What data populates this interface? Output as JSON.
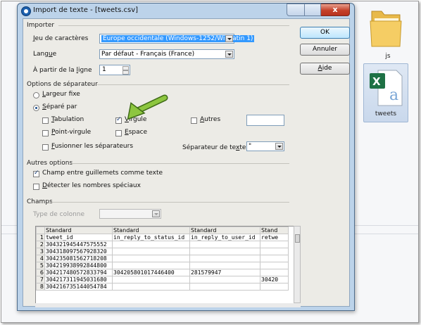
{
  "window": {
    "title": "Import de texte - [tweets.csv]",
    "close_glyph": "x"
  },
  "desktop": {
    "folder_label": "js",
    "file_label": "tweets"
  },
  "importer": {
    "heading": "Importer",
    "charset_label_u": "J",
    "charset_label_rest": "eu de caractères",
    "charset_value": "Europe occidentale (Windows-1252/WinLatin 1)",
    "language_label_a": "Lang",
    "language_label_u": "u",
    "language_label_b": "e",
    "language_value": "Par défaut - Français (France)",
    "from_line_label_a": "À partir de la ",
    "from_line_label_u": "l",
    "from_line_label_b": "igne",
    "from_line_value": "1"
  },
  "buttons": {
    "ok": "OK",
    "cancel": "Annuler",
    "help_u": "A",
    "help_rest": "ide"
  },
  "separator": {
    "heading": "Options de séparateur",
    "fixed_width_u": "L",
    "fixed_width_rest": "argeur fixe",
    "separated_by_u": "S",
    "separated_by_rest": "éparé par",
    "tab_u": "T",
    "tab_rest": "abulation",
    "comma_u": "V",
    "comma_rest": "irgule",
    "others_u": "A",
    "others_rest": "utres",
    "semicolon_u": "P",
    "semicolon_rest": "oint-virgule",
    "space_u": "E",
    "space_rest": "space",
    "merge_u": "F",
    "merge_rest": "usionner les séparateurs",
    "text_delim_label_a": "Séparateur de te",
    "text_delim_label_u": "x",
    "text_delim_label_b": "te",
    "text_delim_value": "\""
  },
  "other_options": {
    "heading": "Autres options",
    "quoted_as_text": "Champ entre guillemets comme texte",
    "detect_special_u": "D",
    "detect_special_rest": "étecter les nombres spéciaux"
  },
  "fields": {
    "heading": "Champs",
    "column_type_label": "Type de colonne",
    "column_headers": [
      "Standard",
      "Standard",
      "Standard",
      "Stand"
    ],
    "rows": [
      {
        "n": "1",
        "c": [
          "tweet_id",
          "in_reply_to_status_id",
          "in_reply_to_user_id",
          "retwe"
        ]
      },
      {
        "n": "2",
        "c": [
          "304321945447575552",
          "",
          "",
          ""
        ]
      },
      {
        "n": "3",
        "c": [
          "304318097567928320",
          "",
          "",
          ""
        ]
      },
      {
        "n": "4",
        "c": [
          "304235081562718208",
          "",
          "",
          ""
        ]
      },
      {
        "n": "5",
        "c": [
          "304219938992844800",
          "",
          "",
          ""
        ]
      },
      {
        "n": "6",
        "c": [
          "304217480572833794",
          "304205801017446400",
          "281579947",
          ""
        ]
      },
      {
        "n": "7",
        "c": [
          "304217311945031680",
          "",
          "",
          "30420"
        ]
      },
      {
        "n": "8",
        "c": [
          "304216735144054784",
          "",
          "",
          ""
        ]
      }
    ]
  },
  "colors": {
    "highlight": "#3399ff",
    "arrow": "#8dc63f"
  },
  "icons": [
    "folder-icon",
    "excel-file-icon",
    "dropdown-arrow-icon",
    "close-icon",
    "pointer-arrow-icon"
  ]
}
